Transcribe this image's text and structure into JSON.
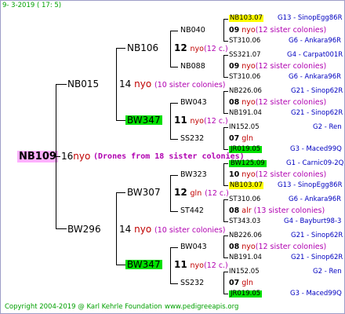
{
  "header": {
    "date": "9-  3-2019 ( 17:  5)"
  },
  "footer": {
    "copyright": "Copyright 2004-2019 @ Karl Kehrle Foundation",
    "website": "www.pedigreeapis.org"
  },
  "root": {
    "id": "NB109",
    "gen": "16",
    "nyo": "nyo",
    "drones": "(Drones from 18 sister colonies)"
  },
  "gen1": {
    "top": {
      "id": "NB015",
      "gen": "14",
      "nyo": "nyo",
      "sis": "(10 sister colonies)"
    },
    "bottom": {
      "id": "BW296",
      "gen": "14",
      "nyo": "nyo",
      "sis": "(10 sister colonies)"
    }
  },
  "gen2": {
    "a": {
      "id": "NB106",
      "gen": "12",
      "nyo": "nyo",
      "sis": "(12 c.)"
    },
    "b": {
      "id": "BW347",
      "gen": "11",
      "nyo": "nyo",
      "sis": "(12 c.)"
    },
    "c": {
      "id": "BW307",
      "gen": "12",
      "nyo": "gln",
      "sis": "(12 c.)"
    },
    "d": {
      "id": "BW347",
      "gen": "11",
      "nyo": "nyo",
      "sis": "(12 c.)"
    }
  },
  "gen3": [
    {
      "id": "NB040",
      "gen": "09",
      "nyo": "nyo",
      "sis": "(12 sister colonies)",
      "top": "NB103.07",
      "top_r": "G13 - SinopEgg86R",
      "bot": "ST310.06",
      "bot_r": "G6 - Ankara96R"
    },
    {
      "id": "NB088",
      "gen": "09",
      "nyo": "nyo",
      "sis": "(12 sister colonies)",
      "top": "SS321.07",
      "top_r": "G4 - Carpat001R",
      "bot": "ST310.06",
      "bot_r": "G6 - Ankara96R"
    },
    {
      "id": "BW043",
      "gen": "08",
      "nyo": "nyo",
      "sis": "(12 sister colonies)",
      "top": "NB226.06",
      "top_r": "G21 - Sinop62R",
      "bot": "NB191.04",
      "bot_r": "G21 - Sinop62R"
    },
    {
      "id": "SS232",
      "gen": "07",
      "nyo": "gln",
      "sis": "",
      "top": "IN152.05",
      "top_r": "G2 - Ren",
      "bot": "JR019.05",
      "bot_r": "G3 - Maced99Q"
    },
    {
      "id": "BW323",
      "gen": "10",
      "nyo": "nyo",
      "sis": "(12 sister colonies)",
      "top": "BW125.09",
      "top_r": "G1 - Carnic09-2Q",
      "bot": "NB103.07",
      "bot_r": "G13 - SinopEgg86R"
    },
    {
      "id": "ST442",
      "gen": "08",
      "nyo": "alr",
      "sis": "(13 sister colonies)",
      "top": "ST310.06",
      "top_r": "G6 - Ankara96R",
      "bot": "ST343.03",
      "bot_r": "G4 - Bayburt98-3"
    },
    {
      "id": "BW043",
      "gen": "08",
      "nyo": "nyo",
      "sis": "(12 sister colonies)",
      "top": "NB226.06",
      "top_r": "G21 - Sinop62R",
      "bot": "NB191.04",
      "bot_r": "G21 - Sinop62R"
    },
    {
      "id": "SS232",
      "gen": "07",
      "nyo": "gln",
      "sis": "",
      "top": "IN152.05",
      "top_r": "G2 - Ren",
      "bot": "JR019.05",
      "bot_r": "G3 - Maced99Q"
    }
  ]
}
